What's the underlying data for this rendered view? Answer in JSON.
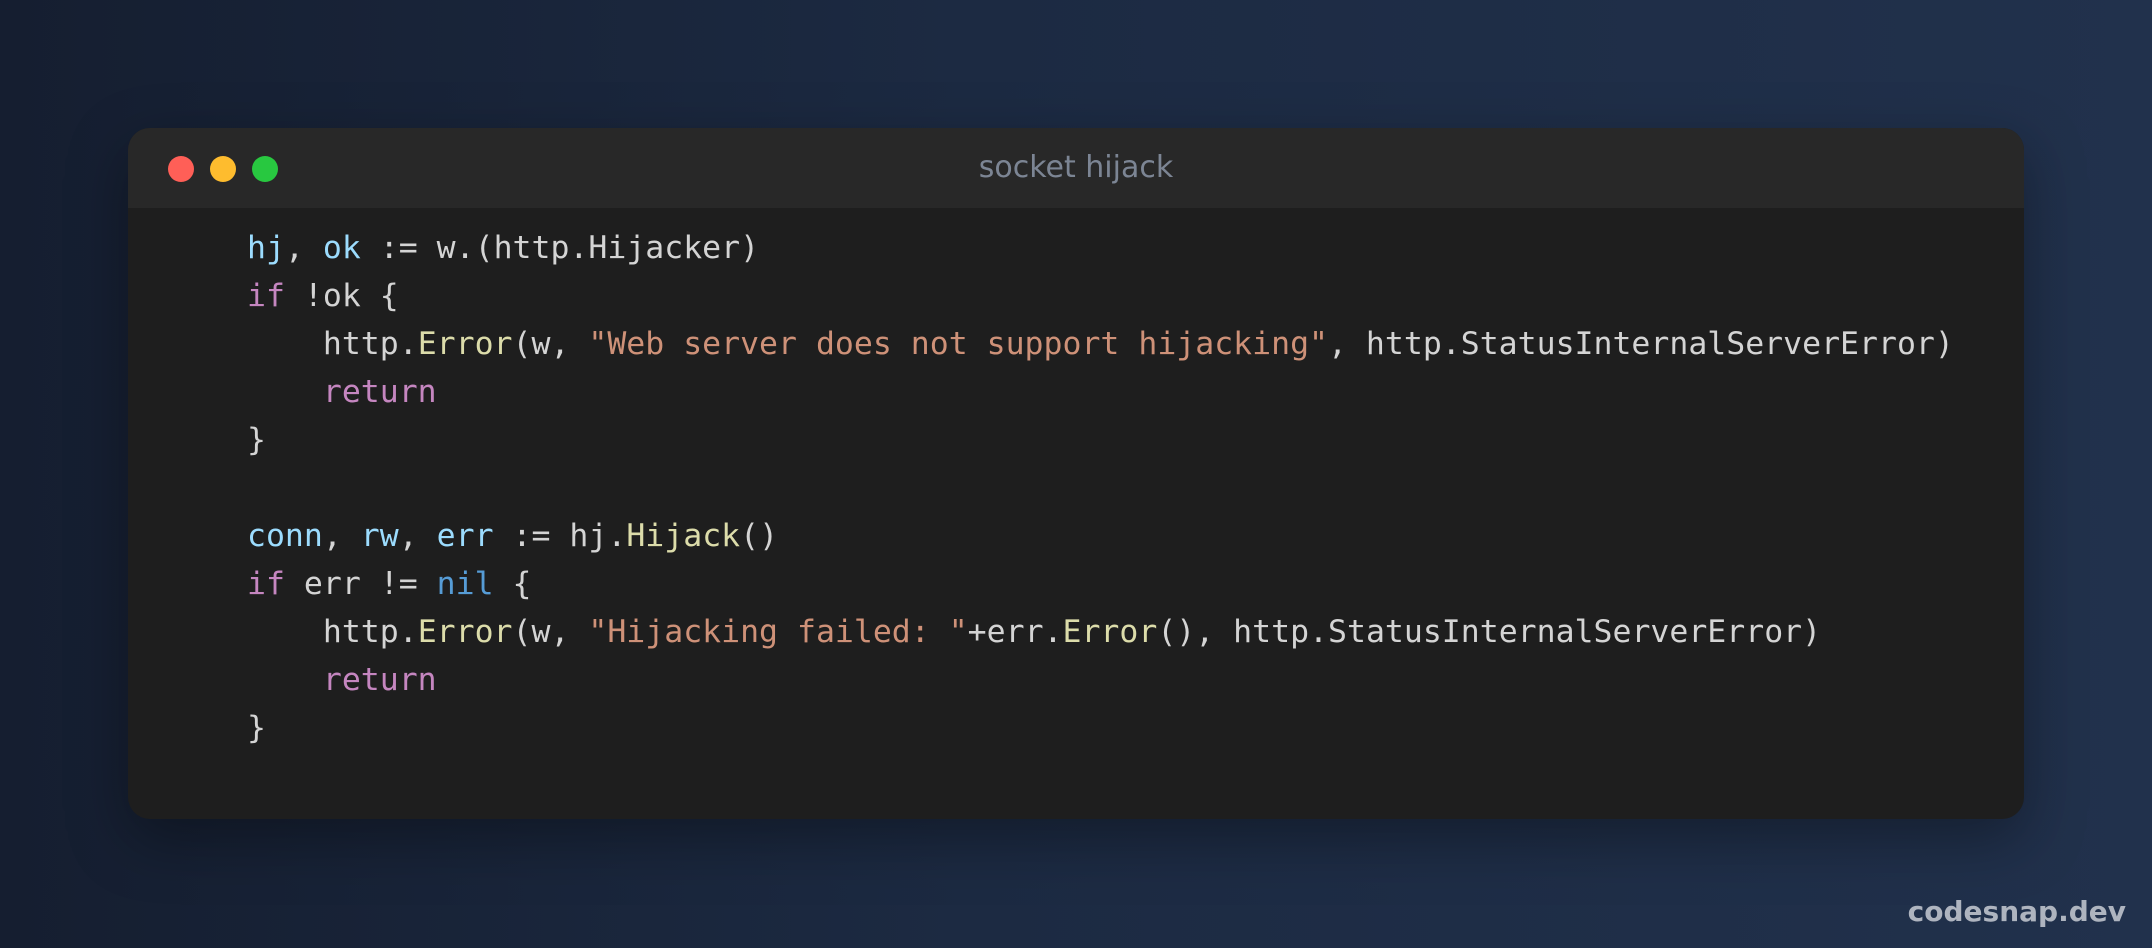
{
  "window": {
    "title": "socket hijack",
    "controls": {
      "close": "#ff5f57",
      "minimize": "#febc2e",
      "zoom": "#28c840"
    }
  },
  "code": {
    "language": "go",
    "line_numbers_shown": false,
    "lines": [
      [
        {
          "text": "hj",
          "type": "var"
        },
        {
          "text": ", ",
          "type": "plain"
        },
        {
          "text": "ok",
          "type": "var"
        },
        {
          "text": " := w.(http.Hijacker)",
          "type": "plain"
        }
      ],
      [
        {
          "text": "if",
          "type": "kw"
        },
        {
          "text": " !ok {",
          "type": "plain"
        }
      ],
      [
        {
          "text": "    http.",
          "type": "plain"
        },
        {
          "text": "Error",
          "type": "fn"
        },
        {
          "text": "(w, ",
          "type": "plain"
        },
        {
          "text": "\"Web server does not support hijacking\"",
          "type": "str"
        },
        {
          "text": ", http.StatusInternalServerError)",
          "type": "plain"
        }
      ],
      [
        {
          "text": "    ",
          "type": "plain"
        },
        {
          "text": "return",
          "type": "kw"
        }
      ],
      [
        {
          "text": "}",
          "type": "plain"
        }
      ],
      [],
      [
        {
          "text": "conn",
          "type": "var"
        },
        {
          "text": ", ",
          "type": "plain"
        },
        {
          "text": "rw",
          "type": "var"
        },
        {
          "text": ", ",
          "type": "plain"
        },
        {
          "text": "err",
          "type": "var"
        },
        {
          "text": " := hj.",
          "type": "plain"
        },
        {
          "text": "Hijack",
          "type": "fn"
        },
        {
          "text": "()",
          "type": "plain"
        }
      ],
      [
        {
          "text": "if",
          "type": "kw"
        },
        {
          "text": " err != ",
          "type": "plain"
        },
        {
          "text": "nil",
          "type": "const"
        },
        {
          "text": " {",
          "type": "plain"
        }
      ],
      [
        {
          "text": "    http.",
          "type": "plain"
        },
        {
          "text": "Error",
          "type": "fn"
        },
        {
          "text": "(w, ",
          "type": "plain"
        },
        {
          "text": "\"Hijacking failed: \"",
          "type": "str"
        },
        {
          "text": "+err.",
          "type": "plain"
        },
        {
          "text": "Error",
          "type": "fn"
        },
        {
          "text": "(), http.StatusInternalServerError)",
          "type": "plain"
        }
      ],
      [
        {
          "text": "    ",
          "type": "plain"
        },
        {
          "text": "return",
          "type": "kw"
        }
      ],
      [
        {
          "text": "}",
          "type": "plain"
        }
      ]
    ]
  },
  "watermark": "codesnap.dev"
}
